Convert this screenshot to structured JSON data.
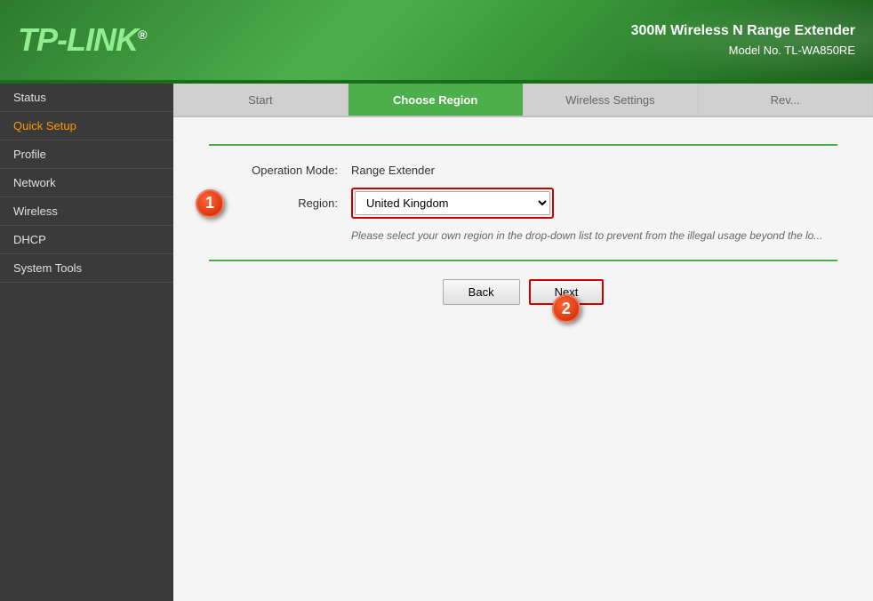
{
  "header": {
    "logo": "TP-LINK",
    "logo_dot": "®",
    "device_name": "300M Wireless N Range Extender",
    "model_no": "Model No. TL-WA850RE"
  },
  "sidebar": {
    "items": [
      {
        "id": "status",
        "label": "Status",
        "active": false,
        "selected": false
      },
      {
        "id": "quick-setup",
        "label": "Quick Setup",
        "active": true,
        "selected": false
      },
      {
        "id": "profile",
        "label": "Profile",
        "active": false,
        "selected": false
      },
      {
        "id": "network",
        "label": "Network",
        "active": false,
        "selected": false
      },
      {
        "id": "wireless",
        "label": "Wireless",
        "active": false,
        "selected": false
      },
      {
        "id": "dhcp",
        "label": "DHCP",
        "active": false,
        "selected": false
      },
      {
        "id": "system-tools",
        "label": "System Tools",
        "active": false,
        "selected": false
      }
    ]
  },
  "steps": [
    {
      "id": "start",
      "label": "Start",
      "active": false
    },
    {
      "id": "choose-region",
      "label": "Choose Region",
      "active": true
    },
    {
      "id": "wireless-settings",
      "label": "Wireless Settings",
      "active": false
    },
    {
      "id": "review",
      "label": "Rev...",
      "active": false
    }
  ],
  "form": {
    "operation_mode_label": "Operation Mode:",
    "operation_mode_value": "Range Extender",
    "region_label": "Region:",
    "region_value": "United Kingdom",
    "region_hint": "Please select your own region in the drop-down list to prevent from the illegal usage beyond the lo..."
  },
  "buttons": {
    "back": "Back",
    "next": "Next"
  },
  "annotations": {
    "one": "1",
    "two": "2"
  }
}
